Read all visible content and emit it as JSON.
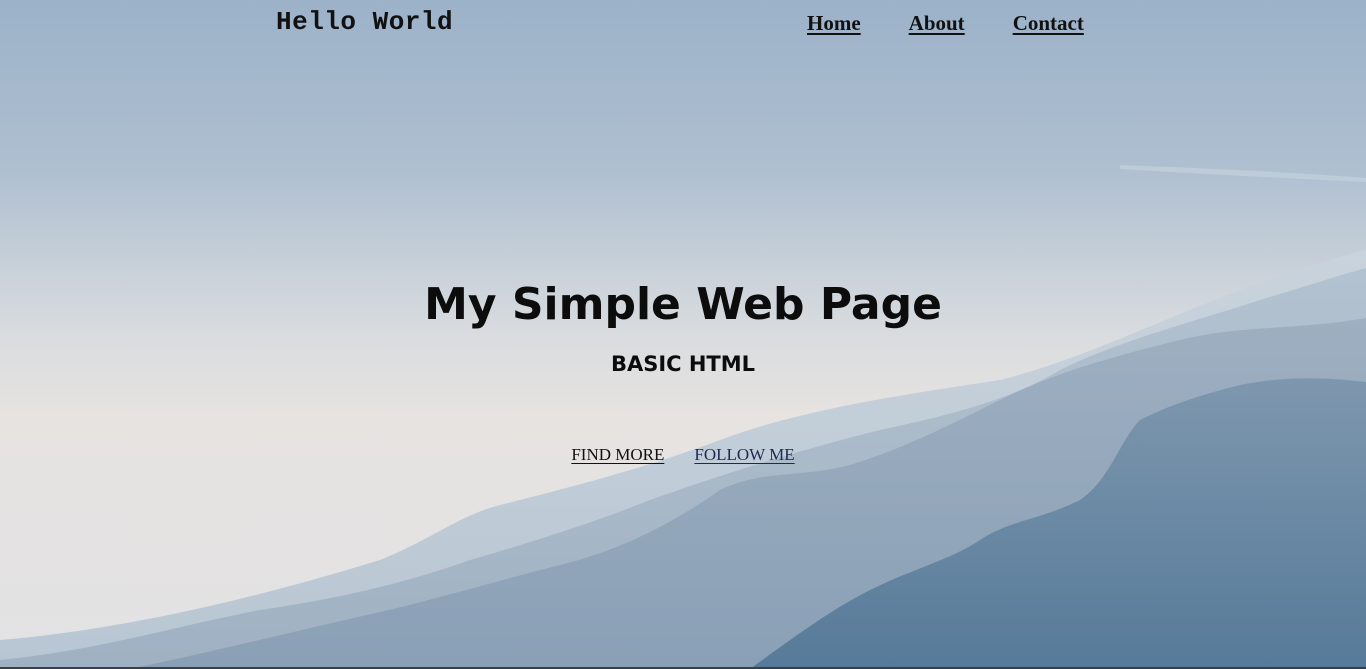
{
  "header": {
    "brand": "Hello World",
    "nav": [
      {
        "label": "Home"
      },
      {
        "label": "About"
      },
      {
        "label": "Contact"
      }
    ]
  },
  "hero": {
    "title": "My Simple Web Page",
    "subtitle": "BASIC HTML",
    "links": [
      {
        "label": "FIND MORE"
      },
      {
        "label": "FOLLOW ME"
      }
    ]
  },
  "colors": {
    "sky_top": "#9fb4cb",
    "sky_haze": "#e4e1df",
    "mountain_dark": "#4f7394",
    "text": "#0c0c0c",
    "link_alt": "#1e2a52"
  }
}
